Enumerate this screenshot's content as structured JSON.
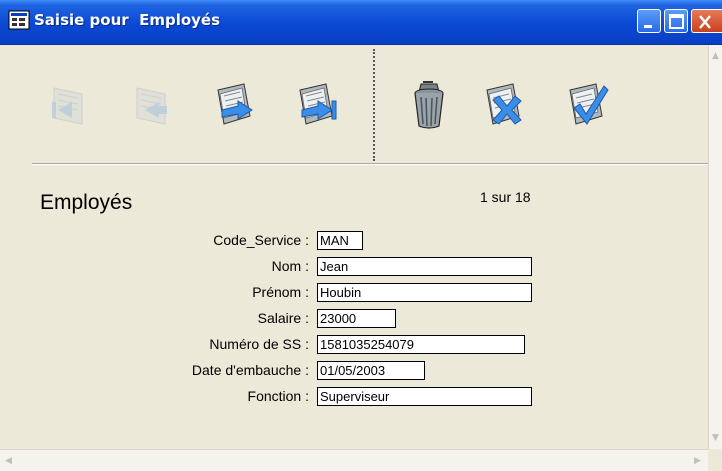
{
  "window": {
    "title": "Saisie pour  Employés"
  },
  "toolbar": {
    "buttons": [
      {
        "name": "first-record-button",
        "icon": "first-record-icon",
        "enabled": false
      },
      {
        "name": "previous-record-button",
        "icon": "previous-record-icon",
        "enabled": false
      },
      {
        "name": "next-record-button",
        "icon": "next-record-icon",
        "enabled": true
      },
      {
        "name": "last-record-button",
        "icon": "last-record-icon",
        "enabled": true
      },
      {
        "name": "delete-record-button",
        "icon": "trash-icon",
        "enabled": true
      },
      {
        "name": "cancel-record-button",
        "icon": "cancel-icon",
        "enabled": true
      },
      {
        "name": "validate-record-button",
        "icon": "validate-icon",
        "enabled": true
      }
    ]
  },
  "form": {
    "title": "Employés",
    "record_counter": "1 sur 18",
    "fields": {
      "code_service": {
        "label": "Code_Service :",
        "value": "MAN"
      },
      "nom": {
        "label": "Nom :",
        "value": "Jean"
      },
      "prenom": {
        "label": "Prénom :",
        "value": "Houbin"
      },
      "salaire": {
        "label": "Salaire :",
        "value": "23000"
      },
      "numero_ss": {
        "label": "Numéro de SS :",
        "value": "1581035254079"
      },
      "date_embauche": {
        "label": "Date d'embauche :",
        "value": "01/05/2003"
      },
      "fonction": {
        "label": "Fonction :",
        "value": "Superviseur"
      }
    }
  },
  "colors": {
    "titlebar": "#0a49d4",
    "window_background": "#ece9d8",
    "accent_blue": "#3a8ee8",
    "accent_green": "#2f9e3f"
  }
}
